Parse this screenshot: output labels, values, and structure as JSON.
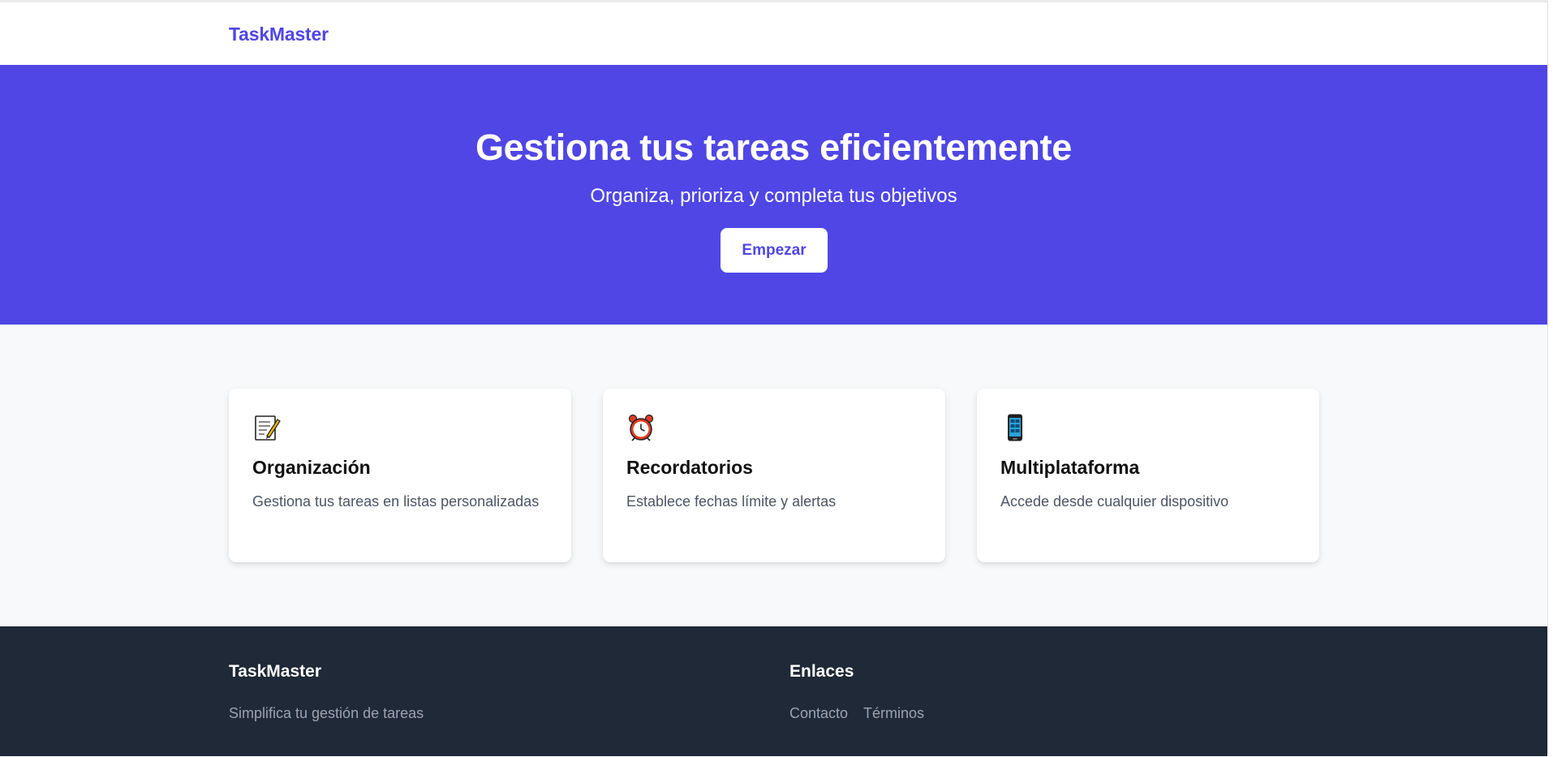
{
  "nav": {
    "brand": "TaskMaster"
  },
  "hero": {
    "title": "Gestiona tus tareas eficientemente",
    "subtitle": "Organiza, prioriza y completa tus objetivos",
    "cta_label": "Empezar"
  },
  "features": [
    {
      "icon": "memo-icon",
      "title": "Organización",
      "text": "Gestiona tus tareas en listas personalizadas"
    },
    {
      "icon": "alarm-clock-icon",
      "title": "Recordatorios",
      "text": "Establece fechas límite y alertas"
    },
    {
      "icon": "mobile-phone-icon",
      "title": "Multiplataforma",
      "text": "Accede desde cualquier dispositivo"
    }
  ],
  "footer": {
    "brand": "TaskMaster",
    "tagline": "Simplifica tu gestión de tareas",
    "links_title": "Enlaces",
    "links": [
      "Contacto",
      "Términos"
    ]
  },
  "colors": {
    "accent": "#4f46e5",
    "footer_bg": "#1f2937",
    "section_bg": "#f8f9fa"
  }
}
